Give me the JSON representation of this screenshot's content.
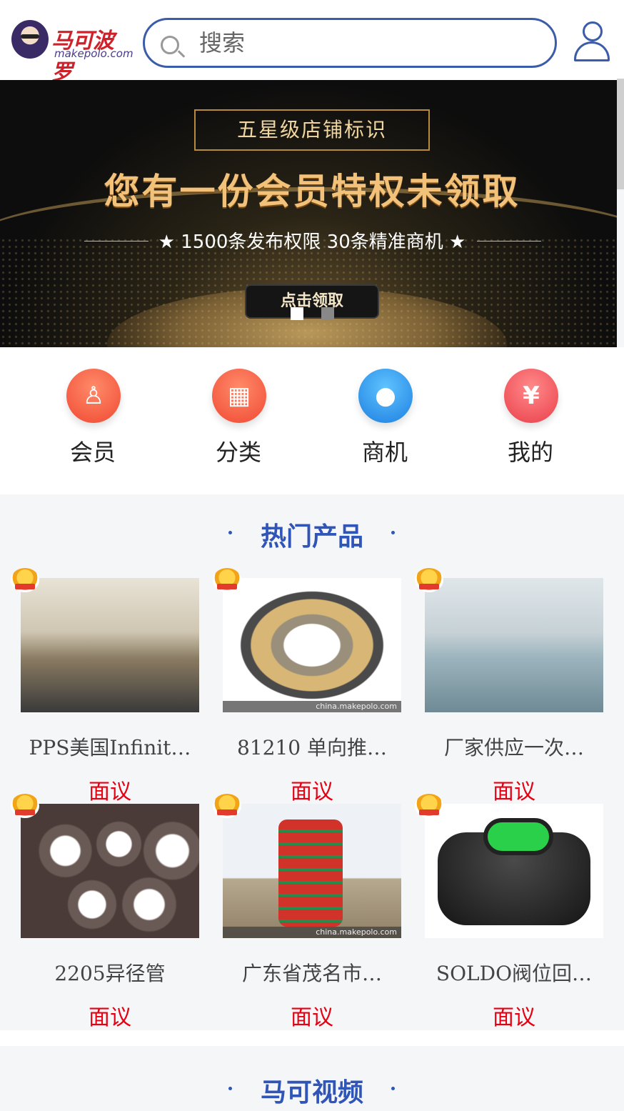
{
  "header": {
    "logo_cn": "马可波罗",
    "logo_en": "makepolo.com",
    "search_placeholder": "搜索"
  },
  "banner": {
    "tag": "五星级店铺标识",
    "title": "您有一份会员特权未领取",
    "subtitle": "★ 1500条发布权限  30条精准商机 ★",
    "button": "点击领取",
    "slides": 2,
    "active_slide": 1
  },
  "quick_nav": [
    {
      "label": "会员",
      "icon": "member-icon"
    },
    {
      "label": "分类",
      "icon": "category-icon"
    },
    {
      "label": "商机",
      "icon": "business-icon"
    },
    {
      "label": "我的",
      "icon": "wallet-icon"
    }
  ],
  "hot_products": {
    "title": "热门产品",
    "items": [
      {
        "name": "PPS美国Infinit…",
        "price": "面议"
      },
      {
        "name": "81210 单向推…",
        "price": "面议",
        "watermark": "china.makepolo.com"
      },
      {
        "name": "厂家供应一次…",
        "price": "面议"
      },
      {
        "name": "2205异径管",
        "price": "面议"
      },
      {
        "name": "广东省茂名市…",
        "price": "面议",
        "watermark": "china.makepolo.com"
      },
      {
        "name": "SOLDO阀位回…",
        "price": "面议"
      }
    ]
  },
  "videos": {
    "title": "马可视频"
  },
  "colors": {
    "brand_blue": "#2f55b8",
    "price_red": "#e60012"
  }
}
